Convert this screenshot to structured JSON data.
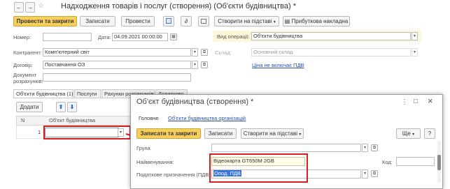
{
  "window": {
    "title": "Надходження товарів і послуг (створення) (Об'єкти будівництва) *",
    "back": "←",
    "forward": "→",
    "star": "☆"
  },
  "toolbar": {
    "post_and_close": "Провести та закрити",
    "save": "Записати",
    "post": "Провести",
    "create_based": "Створити на підставі",
    "invoice": "Прибуткова накладна"
  },
  "header": {
    "number_label": "Номер:",
    "number_value": "",
    "date_label": "Дата:",
    "date_value": "04.09.2021 00:00:00",
    "operation_label": "Вид операції:",
    "operation_value": "Об'єкти будівництва",
    "counterparty_label": "Контрагент:",
    "counterparty_value": "Комп'ютерний світ",
    "warehouse_label": "Склад:",
    "warehouse_value": "Основний склад",
    "contract_label": "Договір:",
    "contract_value": "Поставчання ОЗ",
    "price_link": "Ціна не включає ПДВ",
    "settlement_label_1": "Документ",
    "settlement_label_2": "розрахунків:"
  },
  "tabs": [
    {
      "label": "Об'єкти будівництва (1)"
    },
    {
      "label": "Послуги"
    },
    {
      "label": "Рахунки розрахунків"
    },
    {
      "label": "Додатково"
    }
  ],
  "table": {
    "add_button": "Додати",
    "col_n": "N",
    "col_object": "Об'єкт будівництва",
    "row_n": "1"
  },
  "dialog": {
    "title": "Об'єкт будівництва (створення) *",
    "tab_main": "Головне",
    "tab_org": "Об'єкти будівництва організацій",
    "save_close": "Записати та закрити",
    "save": "Записати",
    "create_based": "Створити на підставі",
    "more": "Ще",
    "help": "?",
    "group_label": "Група",
    "group_value": "",
    "name_label": "Найменування:",
    "name_value": "Відеокарта GT650M 2GB",
    "code_label": "Код:",
    "code_value": "",
    "vat_label": "Податкове призначення (ПДВ):",
    "vat_value": "Опод. ПДВ",
    "menu": "⋮",
    "minimize": "□",
    "close": "×"
  },
  "colors": {
    "primary": "#f9cf5c",
    "highlight": "#d42020",
    "selection": "#3875d7"
  }
}
